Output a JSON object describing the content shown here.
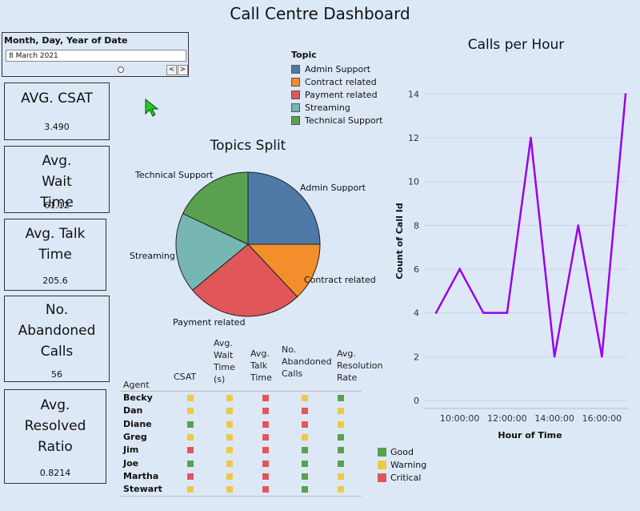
{
  "page": {
    "title": "Call Centre Dashboard"
  },
  "filter": {
    "label": "Month, Day, Year of Date",
    "value": "8 March 2021",
    "prev": "<",
    "next": ">"
  },
  "kpis": [
    {
      "title": "AVG. CSAT",
      "value": "3.490"
    },
    {
      "title": "Avg. Wait Time",
      "value": "61.12"
    },
    {
      "title": "Avg. Talk Time",
      "value": "205.6"
    },
    {
      "title": "No. Abandoned Calls",
      "value": "56"
    },
    {
      "title": "Avg. Resolved Ratio",
      "value": "0.8214"
    }
  ],
  "colors": {
    "admin": "#4e79a7",
    "contract": "#f28e2b",
    "payment": "#e15759",
    "streaming": "#76b7b2",
    "technical": "#59a14f",
    "good": "#59a14f",
    "warning": "#edc948",
    "critical": "#e15759",
    "line": "#9900ee"
  },
  "topic_legend": {
    "title": "Topic",
    "items": [
      "Admin Support",
      "Contract related",
      "Payment related",
      "Streaming",
      "Technical Support"
    ]
  },
  "chart_data": [
    {
      "type": "pie",
      "title": "Topics Split",
      "categories": [
        "Admin Support",
        "Contract related",
        "Payment related",
        "Streaming",
        "Technical Support"
      ],
      "values": [
        25,
        13,
        26,
        18,
        18
      ]
    },
    {
      "type": "line",
      "title": "Calls per Hour",
      "xlabel": "Hour of Time",
      "ylabel": "Count of Call Id",
      "x": [
        "9:00",
        "10:00",
        "11:00",
        "12:00",
        "13:00",
        "14:00",
        "15:00",
        "16:00",
        "17:00"
      ],
      "y": [
        4,
        6,
        4,
        4,
        12,
        2,
        8,
        2,
        14
      ],
      "x_ticks": [
        "10:00:00",
        "12:00:00",
        "14:00:00",
        "16:00:00"
      ],
      "y_ticks": [
        "0",
        "2",
        "4",
        "6",
        "8",
        "10",
        "12",
        "14"
      ],
      "ylim": [
        0,
        15
      ],
      "grid": true
    }
  ],
  "agents": {
    "header_agent": "Agent",
    "columns": [
      "CSAT",
      "Avg. Wait Time (s)",
      "Avg. Talk Time",
      "No. Abandoned Calls",
      "Avg. Resolution Rate"
    ],
    "rows": [
      {
        "name": "Becky",
        "status": [
          "warning",
          "warning",
          "critical",
          "warning",
          "good"
        ]
      },
      {
        "name": "Dan",
        "status": [
          "warning",
          "warning",
          "critical",
          "critical",
          "warning"
        ]
      },
      {
        "name": "Diane",
        "status": [
          "good",
          "warning",
          "critical",
          "critical",
          "warning"
        ]
      },
      {
        "name": "Greg",
        "status": [
          "warning",
          "warning",
          "critical",
          "warning",
          "good"
        ]
      },
      {
        "name": "Jim",
        "status": [
          "critical",
          "warning",
          "critical",
          "good",
          "good"
        ]
      },
      {
        "name": "Joe",
        "status": [
          "good",
          "warning",
          "critical",
          "good",
          "good"
        ]
      },
      {
        "name": "Martha",
        "status": [
          "critical",
          "warning",
          "critical",
          "good",
          "warning"
        ]
      },
      {
        "name": "Stewart",
        "status": [
          "warning",
          "warning",
          "critical",
          "good",
          "warning"
        ]
      }
    ]
  },
  "status_legend": [
    "Good",
    "Warning",
    "Critical"
  ]
}
